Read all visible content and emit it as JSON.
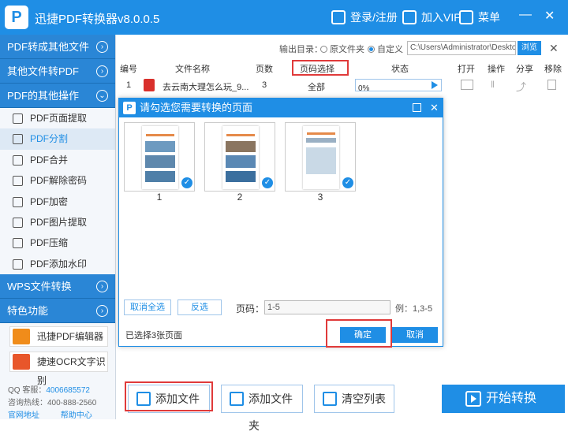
{
  "app": {
    "title": "迅捷PDF转换器v8.0.0.5",
    "login": "登录/注册",
    "vip": "加入VIP",
    "menu": "菜单"
  },
  "sidebar": {
    "sections": [
      {
        "label": "PDF转成其他文件",
        "arrow": "›"
      },
      {
        "label": "其他文件转PDF",
        "arrow": "›"
      },
      {
        "label": "PDF的其他操作",
        "arrow": "⌄"
      }
    ],
    "items": [
      {
        "label": "PDF页面提取"
      },
      {
        "label": "PDF分割"
      },
      {
        "label": "PDF合并"
      },
      {
        "label": "PDF解除密码"
      },
      {
        "label": "PDF加密"
      },
      {
        "label": "PDF图片提取"
      },
      {
        "label": "PDF压缩"
      },
      {
        "label": "PDF添加水印"
      }
    ],
    "wps": "WPS文件转换",
    "special": "特色功能",
    "promo1": "迅捷PDF编辑器",
    "promo2": "捷速OCR文字识别",
    "qq_label": "QQ 客服：",
    "qq_number": "4006685572",
    "hotline_label": "咨询热线：",
    "hotline": "400-888-2560",
    "website": "官网地址",
    "help": "帮助中心"
  },
  "output": {
    "label": "输出目录：",
    "opt1": "原文件夹",
    "opt2": "自定义",
    "path": "C:\\Users\\Administrator\\Deskto",
    "browse": "浏览"
  },
  "table": {
    "headers": [
      "编号",
      "文件名称",
      "页数",
      "页码选择",
      "状态",
      "打开",
      "操作",
      "分享",
      "移除"
    ],
    "row": {
      "index": "1",
      "name": "去云南大理怎么玩_9...",
      "pages": "3",
      "selection": "全部",
      "progress": "0%"
    }
  },
  "dialog": {
    "title": "请勾选您需要转换的页面",
    "pages": [
      "1",
      "2",
      "3"
    ],
    "deselect_all": "取消全选",
    "invert": "反选",
    "pagenum_label": "页码：",
    "pagenum_value": "1-5",
    "example": "例：1,3-5",
    "selected": "已选择3张页面",
    "ok": "确定",
    "cancel": "取消"
  },
  "bottom": {
    "add_file": "添加文件",
    "add_folder": "添加文件夹",
    "clear": "清空列表",
    "start": "开始转换"
  }
}
